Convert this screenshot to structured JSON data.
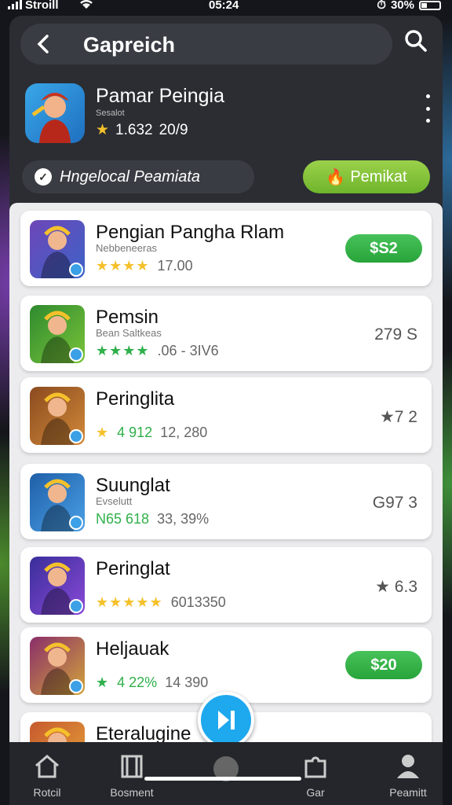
{
  "status": {
    "carrier": "Stroill",
    "time": "05:24",
    "battery": "30%"
  },
  "search": {
    "title": "Gapreich"
  },
  "app": {
    "title": "Pamar Peingia",
    "subtitle": "Sesalot",
    "rating": "1.632",
    "count": "20/9"
  },
  "chip": {
    "label": "Hngelocal Peamiata"
  },
  "cta": {
    "label": "Pemikat"
  },
  "list": [
    {
      "title": "Pengian Pangha Rlam",
      "sub": "Nebbeneeras",
      "stars": "★★★★",
      "score": "17.00",
      "price": "$S2",
      "price_type": "button",
      "icon_colors": [
        "#6e46b8",
        "#3c63c7"
      ]
    },
    {
      "title": "Pemsin",
      "sub": "Bean Saltkeas",
      "stars": "★★★★",
      "score": ".06 - 3IV6",
      "price": "279 S",
      "price_type": "text",
      "icon_colors": [
        "#2e8a2e",
        "#7ac43a"
      ]
    },
    {
      "title": "Peringlita",
      "sub": "",
      "stars": "★",
      "score": "12, 280",
      "rating_value": "4 912",
      "price": "★7 2",
      "price_type": "text",
      "icon_colors": [
        "#8a4a1e",
        "#d28a3a"
      ]
    },
    {
      "title": "Suunglat",
      "sub": "Evselutt",
      "stars": "",
      "score": "33, 39%",
      "rating_value": "N65 618",
      "price": "G97 3",
      "price_type": "text",
      "icon_colors": [
        "#1f5fa8",
        "#4aa0e6"
      ]
    },
    {
      "title": "Peringlat",
      "sub": "",
      "stars": "★★★★★",
      "score": "6013350",
      "price": "★ 6.3",
      "price_type": "text",
      "icon_colors": [
        "#3a2e9a",
        "#8a4ad8"
      ]
    },
    {
      "title": "Heljauak",
      "sub": "",
      "stars": "★",
      "score": "14 390",
      "rating_value": "4 22%",
      "price": "$20",
      "price_type": "button",
      "icon_colors": [
        "#8a2e6a",
        "#d2a43a"
      ]
    },
    {
      "title": "Eteralugine",
      "sub": "",
      "stars": "",
      "score": "",
      "price": "",
      "price_type": "none",
      "icon_colors": [
        "#c65a2e",
        "#e6a43a"
      ]
    }
  ],
  "tabs": {
    "home": "Rotcil",
    "browse": "Bosment",
    "car": "Gar",
    "profile": "Peamitt"
  }
}
